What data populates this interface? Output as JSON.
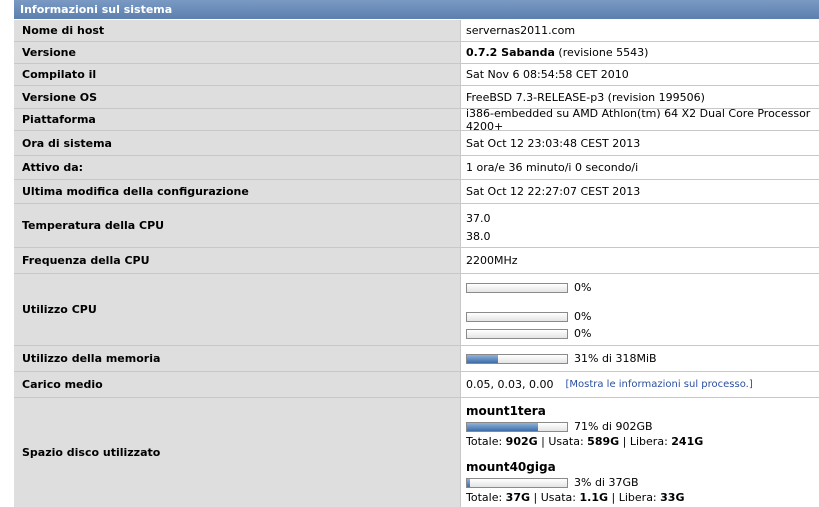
{
  "header": {
    "title": "Informazioni sul sistema"
  },
  "rows": {
    "hostname": {
      "label": "Nome di host",
      "value": "servernas2011.com"
    },
    "version": {
      "label": "Versione",
      "value_bold": "0.7.2 Sabanda",
      "value_rest": "(revisione 5543)"
    },
    "build": {
      "label": "Compilato il",
      "value": "Sat Nov 6 08:54:58 CET 2010"
    },
    "os": {
      "label": "Versione OS",
      "value": "FreeBSD 7.3-RELEASE-p3 (revision 199506)"
    },
    "platform": {
      "label": "Piattaforma",
      "value": "i386-embedded su AMD Athlon(tm) 64 X2 Dual Core Processor 4200+"
    },
    "systime": {
      "label": "Ora di sistema",
      "value": "Sat Oct 12 23:03:48 CEST 2013"
    },
    "uptime": {
      "label": "Attivo da:",
      "value": "1 ora/e 36 minuto/i 0 secondo/i"
    },
    "lastconfig": {
      "label": "Ultima modifica della configurazione",
      "value": "Sat Oct 12 22:27:07 CEST 2013"
    },
    "cputemp": {
      "label": "Temperatura della CPU",
      "values": [
        "37.0",
        "38.0"
      ]
    },
    "cpufreq": {
      "label": "Frequenza della CPU",
      "value": "2200MHz"
    },
    "cpuusage": {
      "label": "Utilizzo CPU",
      "bars": [
        {
          "percent": 0,
          "text": "0%"
        },
        {
          "percent": 0,
          "text": "0%"
        },
        {
          "percent": 0,
          "text": "0%"
        }
      ]
    },
    "memory": {
      "label": "Utilizzo della memoria",
      "percent": 31,
      "text": "31% di 318MiB"
    },
    "load": {
      "label": "Carico medio",
      "value": "0.05, 0.03, 0.00",
      "link": "[Mostra le informazioni sul processo.]"
    },
    "disk": {
      "label": "Spazio disco utilizzato",
      "mounts": [
        {
          "name": "mount1tera",
          "percent": 71,
          "text": "71% di 902GB",
          "total_label": "Totale:",
          "total": "902G",
          "used_label": "| Usata:",
          "used": "589G",
          "free_label": "| Libera:",
          "free": "241G"
        },
        {
          "name": "mount40giga",
          "percent": 3,
          "text": "3% di 37GB",
          "total_label": "Totale:",
          "total": "37G",
          "used_label": "| Usata:",
          "used": "1.1G",
          "free_label": "| Libera:",
          "free": "33G"
        }
      ]
    }
  }
}
